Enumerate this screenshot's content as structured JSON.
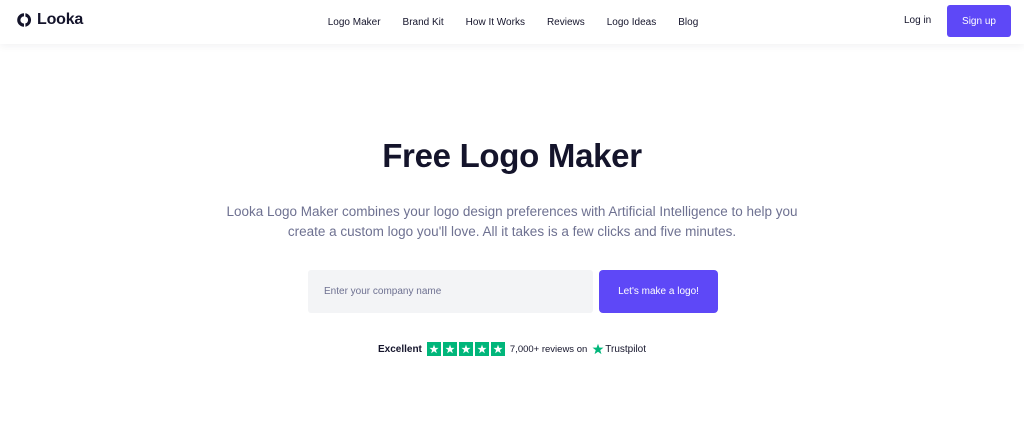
{
  "brand": {
    "name": "Looka",
    "logo_icon": "looka-logo-icon"
  },
  "nav": {
    "items": [
      {
        "label": "Logo Maker"
      },
      {
        "label": "Brand Kit"
      },
      {
        "label": "How It Works"
      },
      {
        "label": "Reviews"
      },
      {
        "label": "Logo Ideas"
      },
      {
        "label": "Blog"
      }
    ]
  },
  "auth": {
    "login_label": "Log in",
    "signup_label": "Sign up"
  },
  "hero": {
    "title": "Free Logo Maker",
    "subtitle_line1": "Looka Logo Maker combines your logo design preferences with Artificial Intelligence to help you",
    "subtitle_line2": "create a custom logo you'll love. All it takes is a few clicks and five minutes.",
    "input_placeholder": "Enter your company name",
    "input_value": "",
    "cta_label": "Let's make a logo!"
  },
  "trust": {
    "rating_label": "Excellent",
    "stars": 5,
    "reviews_text": "7,000+ reviews on",
    "platform": "Trustpilot",
    "platform_icon": "trustpilot-star-icon"
  },
  "colors": {
    "accent": "#5e48f7",
    "text_dark": "#14142b",
    "text_muted": "#6e7191",
    "input_bg": "#f3f4f6",
    "trustpilot_green": "#00b67a"
  }
}
